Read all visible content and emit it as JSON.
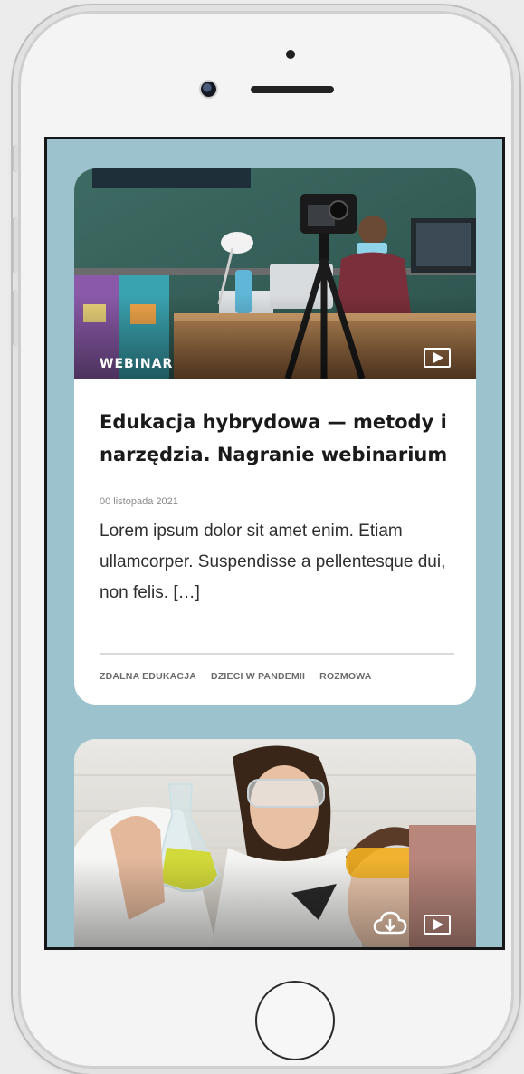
{
  "device": {
    "type": "smartphone"
  },
  "feed": {
    "cards": [
      {
        "category": "WEBINAR",
        "title": "Edukacja hybrydowa — metody i narzędzia. Nagranie webinarium",
        "date": "00 listopada 2021",
        "excerpt": "Lorem ipsum dolor sit amet enim. Etiam ullamcorper. Suspendisse a pellentesque dui, non felis.  […]",
        "tags": [
          "ZDALNA EDUKACJA",
          "DZIECI W PANDEMII",
          "ROZMOWA"
        ],
        "icons": [
          "play-icon"
        ]
      },
      {
        "icons": [
          "cloud-download-icon",
          "play-icon"
        ]
      }
    ]
  },
  "colors": {
    "screen_background": "#9cc3cd",
    "card_background": "#ffffff"
  }
}
